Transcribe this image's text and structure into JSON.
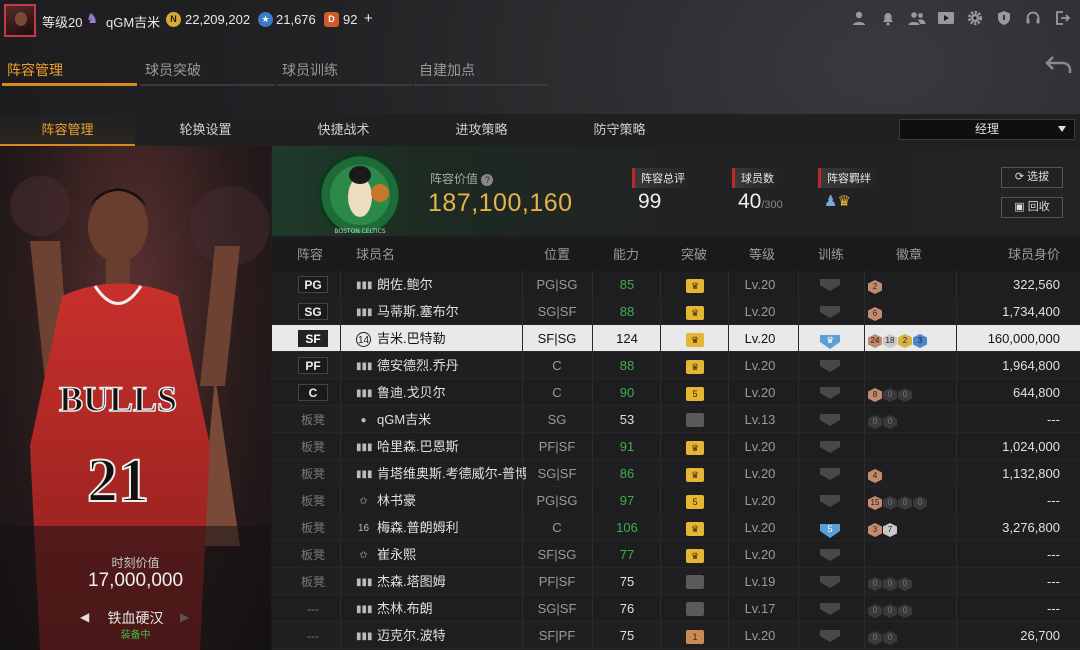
{
  "topbar": {
    "level": "等级20",
    "username": "qGM吉米",
    "coins": "22,209,202",
    "stars": "21,676",
    "points": "92",
    "add": "+"
  },
  "tabs_main": [
    "阵容管理",
    "球员突破",
    "球员训练",
    "自建加点"
  ],
  "tabs_sub": [
    "阵容管理",
    "轮换设置",
    "快捷战术",
    "进攻策略",
    "防守策略"
  ],
  "role_select": "经理",
  "card": {
    "moment_label": "时刻价值",
    "moment_value": "17,000,000",
    "name": "铁血硬汉",
    "status": "装备中",
    "jersey_team": "BULLS",
    "jersey_number": "21"
  },
  "team": {
    "logo_text": "BOSTON CELTICS",
    "value_label": "阵容价值",
    "value": "187,100,160",
    "rating_label": "阵容总评",
    "rating": "99",
    "count_label": "球员数",
    "count": "40",
    "count_max": "/300",
    "bond_label": "阵容羁绊",
    "select_btn": "选拔",
    "recycle_btn": "回收"
  },
  "table": {
    "headers": [
      "阵容",
      "球员名",
      "位置",
      "能力",
      "突破",
      "等级",
      "训练",
      "徽章",
      "球员身价"
    ],
    "rows": [
      {
        "slot": "PG",
        "name": "朗佐.鲍尔",
        "pos": "PG|SG",
        "ability": "85",
        "level": "Lv.20",
        "badges": [
          "2"
        ],
        "value": "322,560"
      },
      {
        "slot": "SG",
        "name": "马蒂斯.塞布尔",
        "pos": "SG|SF",
        "ability": "88",
        "level": "Lv.20",
        "badges": [
          "6"
        ],
        "value": "1,734,400"
      },
      {
        "slot": "SF",
        "name": "吉米.巴特勒",
        "pos": "SF|SG",
        "ability": "124",
        "level": "Lv.20",
        "badges": [
          "24",
          "18",
          "2",
          "3"
        ],
        "value": "160,000,000"
      },
      {
        "slot": "PF",
        "name": "德安德烈.乔丹",
        "pos": "C",
        "ability": "88",
        "level": "Lv.20",
        "badges": [],
        "value": "1,964,800"
      },
      {
        "slot": "C",
        "name": "鲁迪.戈贝尔",
        "pos": "C",
        "ability": "90",
        "level": "Lv.20",
        "badges": [
          "8",
          "0",
          "0"
        ],
        "value": "644,800"
      },
      {
        "slot": "板凳",
        "name": "qGM吉米",
        "pos": "SG",
        "ability": "53",
        "level": "Lv.13",
        "badges": [
          "0",
          "0"
        ],
        "value": "---"
      },
      {
        "slot": "板凳",
        "name": "哈里森.巴恩斯",
        "pos": "PF|SF",
        "ability": "91",
        "level": "Lv.20",
        "badges": [],
        "value": "1,024,000"
      },
      {
        "slot": "板凳",
        "name": "肯塔维奥斯.考德威尔-普博",
        "pos": "SG|SF",
        "ability": "86",
        "level": "Lv.20",
        "badges": [
          "4"
        ],
        "value": "1,132,800"
      },
      {
        "slot": "板凳",
        "name": "林书豪",
        "pos": "PG|SG",
        "ability": "97",
        "level": "Lv.20",
        "badges": [
          "15",
          "0",
          "0",
          "0"
        ],
        "value": "---"
      },
      {
        "slot": "板凳",
        "name": "梅森.普朗姆利",
        "pos": "C",
        "ability": "106",
        "level": "Lv.20",
        "badges": [
          "3",
          "7"
        ],
        "value": "3,276,800"
      },
      {
        "slot": "板凳",
        "name": "崔永熙",
        "pos": "SF|SG",
        "ability": "77",
        "level": "Lv.20",
        "badges": [],
        "value": "---"
      },
      {
        "slot": "板凳",
        "name": "杰森.塔图姆",
        "pos": "PF|SF",
        "ability": "75",
        "level": "Lv.19",
        "badges": [
          "0",
          "0",
          "0"
        ],
        "value": "---"
      },
      {
        "slot": "---",
        "name": "杰林.布朗",
        "pos": "SG|SF",
        "ability": "76",
        "level": "Lv.17",
        "badges": [
          "0",
          "0",
          "0"
        ],
        "value": "---"
      },
      {
        "slot": "---",
        "name": "迈克尔.波特",
        "pos": "SF|PF",
        "ability": "75",
        "level": "Lv.20",
        "badges": [
          "0",
          "0"
        ],
        "value": "26,700"
      }
    ],
    "breakthrough": [
      "crown",
      "crown",
      "crown",
      "crown",
      "5",
      "grey",
      "crown",
      "crown",
      "5",
      "crown",
      "crown",
      "grey",
      "grey",
      "1"
    ],
    "training": [
      "",
      "",
      "shield",
      "",
      "",
      "",
      "",
      "",
      "",
      "5",
      "",
      "",
      "",
      ""
    ],
    "player_num_16": "16",
    "player_num_14": "14"
  },
  "colors": {
    "accent": "#d98a1e",
    "value_gold": "#e6b24a",
    "ability_green": "#3fae49",
    "status_green": "#3fbf4a",
    "red_marker": "#c0262c"
  }
}
